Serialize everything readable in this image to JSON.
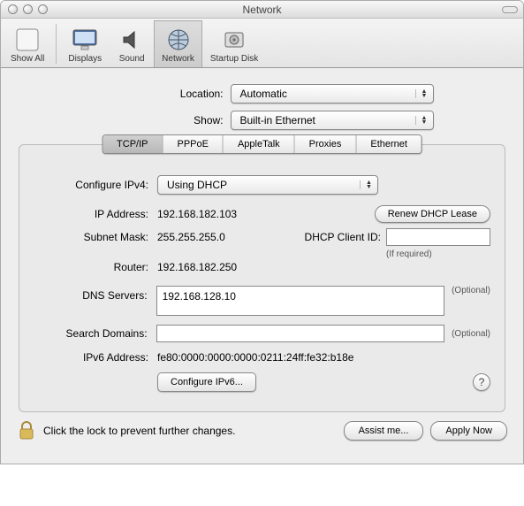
{
  "window": {
    "title": "Network"
  },
  "toolbar": {
    "show_all": "Show All",
    "displays": "Displays",
    "sound": "Sound",
    "network": "Network",
    "startup_disk": "Startup Disk"
  },
  "selectors": {
    "location_label": "Location:",
    "location_value": "Automatic",
    "show_label": "Show:",
    "show_value": "Built-in Ethernet"
  },
  "tabs": {
    "tcpip": "TCP/IP",
    "pppoe": "PPPoE",
    "appletalk": "AppleTalk",
    "proxies": "Proxies",
    "ethernet": "Ethernet"
  },
  "configure": {
    "label": "Configure IPv4:",
    "value": "Using DHCP"
  },
  "ip": {
    "label": "IP Address:",
    "value": "192.168.182.103"
  },
  "renew_btn": "Renew DHCP Lease",
  "subnet": {
    "label": "Subnet Mask:",
    "value": "255.255.255.0"
  },
  "dhcp_client": {
    "label": "DHCP Client ID:",
    "value": "",
    "hint": "(If required)"
  },
  "router": {
    "label": "Router:",
    "value": "192.168.182.250"
  },
  "dns": {
    "label": "DNS Servers:",
    "value": "192.168.128.10",
    "optional": "(Optional)"
  },
  "search_domains": {
    "label": "Search Domains:",
    "value": "",
    "optional": "(Optional)"
  },
  "ipv6": {
    "label": "IPv6 Address:",
    "value": "fe80:0000:0000:0000:0211:24ff:fe32:b18e"
  },
  "configure_ipv6_btn": "Configure IPv6...",
  "help_btn": "?",
  "footer": {
    "lock_text": "Click the lock to prevent further changes.",
    "assist_btn": "Assist me...",
    "apply_btn": "Apply Now"
  }
}
